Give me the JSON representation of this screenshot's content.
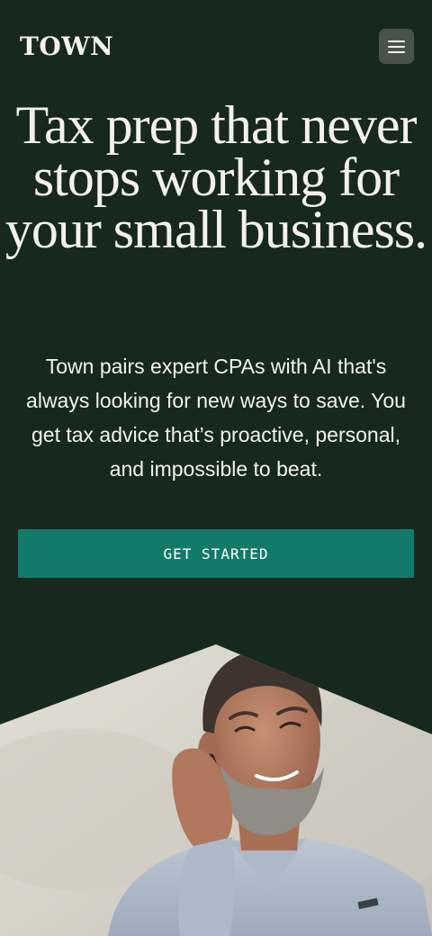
{
  "header": {
    "logo_text": "TOWN",
    "menu_icon": "hamburger-menu-icon"
  },
  "hero": {
    "headline": "Tax prep that never stops working for your small business.",
    "subtext": "Town pairs expert CPAs with AI that's always looking for new ways to save. You get tax advice that’s proactive, personal, and impossible to beat.",
    "cta_label": "GET STARTED",
    "image_subject": "smiling-man-on-phone-photo"
  },
  "colors": {
    "background": "#17291f",
    "text": "#f4f1ea",
    "cta_background": "#137a69",
    "menu_button_background": "#4a524e"
  }
}
